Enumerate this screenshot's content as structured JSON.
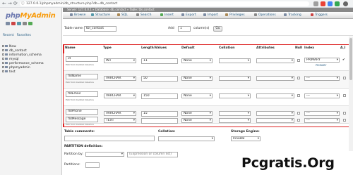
{
  "browser": {
    "url": "127.0.0.1/phpmyadmin/db_structure.php?db=db_contact",
    "back": "←",
    "forward": "→",
    "reload": "⟳"
  },
  "sidebar": {
    "logo_php": "php",
    "logo_admin": "MyAdmin",
    "tabs": [
      "Recent",
      "Favorites"
    ],
    "tree": [
      "New",
      "db_contact",
      "information_schema",
      "mysql",
      "performance_schema",
      "phpmyadmin",
      "test"
    ]
  },
  "breadcrumb": "Server: 127.0.0.1 » Database: db_contact » Table: tbl_contact",
  "menu": [
    "Browse",
    "Structure",
    "SQL",
    "Search",
    "Insert",
    "Export",
    "Import",
    "Privileges",
    "Operations",
    "Tracking",
    "Triggers"
  ],
  "table_form": {
    "name_label": "Table name:",
    "name_value": "tbl_contact",
    "add_label": "Add",
    "add_value": "1",
    "columns_label": "column(s)",
    "go_label": "Go"
  },
  "headers": [
    "Name",
    "Type",
    "Length/Values",
    "Default",
    "Collation",
    "Attributes",
    "Null",
    "Index",
    "A_I"
  ],
  "note": "Pick from Central Columns",
  "index_sub": "PRIMARY",
  "rows": [
    {
      "name": "id",
      "type": "INT",
      "length": "11",
      "default": "None",
      "index": "PRIMARY",
      "ai": "✔"
    },
    {
      "name": "fldName",
      "type": "VARCHAR",
      "length": "50",
      "default": "None",
      "index": "---",
      "ai": ""
    },
    {
      "name": "fldEmail",
      "type": "VARCHAR",
      "length": "150",
      "default": "None",
      "index": "---",
      "ai": ""
    },
    {
      "name": "fldPhone",
      "type": "VARCHAR",
      "length": "15",
      "default": "None",
      "index": "---",
      "ai": ""
    },
    {
      "name": "fldMessage",
      "type": "TEXT",
      "length": "",
      "default": "None",
      "index": "---",
      "ai": ""
    }
  ],
  "bottom": {
    "comments_label": "Table comments:",
    "collation_label": "Collation:",
    "engine_label": "Storage Engine:",
    "engine_value": "InnoDB",
    "partition_title": "PARTITION definition:",
    "partition_by_label": "Partition by:",
    "expression_placeholder": "(Expression or column list)",
    "partitions_label": "Partitions:"
  },
  "watermark": "Pcgratis.Org",
  "colors": {
    "accent": "#235a81",
    "php": "#6c78af",
    "admin": "#f89c0e",
    "highlight": "#dd2222"
  }
}
